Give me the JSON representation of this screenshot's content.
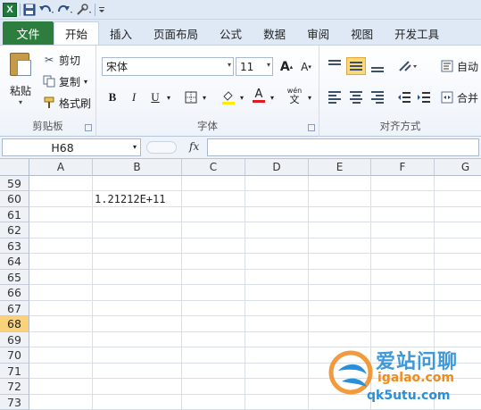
{
  "qat": {
    "icons": [
      "excel-icon",
      "save-icon",
      "undo-icon",
      "redo-icon",
      "customize-icon"
    ]
  },
  "tabs": {
    "file": "文件",
    "items": [
      "开始",
      "插入",
      "页面布局",
      "公式",
      "数据",
      "审阅",
      "视图",
      "开发工具"
    ],
    "active": "开始"
  },
  "clipboard": {
    "paste": "粘贴",
    "cut": "剪切",
    "copy": "复制",
    "format_painter": "格式刷",
    "label": "剪贴板"
  },
  "font": {
    "name": "宋体",
    "size": "11",
    "grow": "A",
    "shrink": "A",
    "bold": "B",
    "italic": "I",
    "underline": "U",
    "color_glyph": "A",
    "phonetic": "wén",
    "label": "字体"
  },
  "alignment": {
    "wrap_text": "自动",
    "merge": "合并",
    "label": "对齐方式"
  },
  "formula_bar": {
    "name_box": "H68",
    "fx": "fx",
    "value": ""
  },
  "sheet": {
    "columns": [
      "A",
      "B",
      "C",
      "D",
      "E",
      "F",
      "G"
    ],
    "rows": [
      "59",
      "60",
      "61",
      "62",
      "63",
      "64",
      "65",
      "66",
      "67",
      "68",
      "69",
      "70",
      "71",
      "72",
      "73"
    ],
    "selected_row": "68",
    "b60": "1.21212E+11"
  },
  "watermark": {
    "text1": "爱站问聊",
    "text2": "igalao.com",
    "text3": "qk5utu.com"
  },
  "colors": {
    "file_tab": "#2d7d3f",
    "selected": "#f9d27b",
    "ribbon_bg": "#dfe9f5"
  }
}
